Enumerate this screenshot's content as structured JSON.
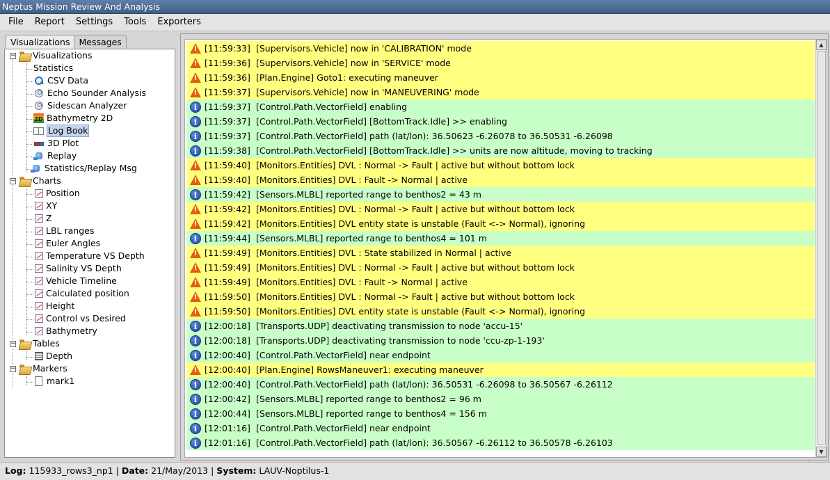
{
  "window": {
    "title": "Neptus Mission Review And Analysis"
  },
  "menu": [
    "File",
    "Report",
    "Settings",
    "Tools",
    "Exporters"
  ],
  "tabs": {
    "visualizations": "Visualizations",
    "messages": "Messages"
  },
  "tree": {
    "visualizations": "Visualizations",
    "statistics": "Statistics",
    "csv_data": "CSV Data",
    "echo_sounder": "Echo Sounder Analysis",
    "sidescan": "Sidescan Analyzer",
    "bathymetry2d": "Bathymetry 2D",
    "bathymetry2d_icon_text": "2D",
    "log_book": "Log Book",
    "plot3d": "3D Plot",
    "replay": "Replay",
    "statistics_replay": "Statistics/Replay Msg",
    "charts": "Charts",
    "chart_items": [
      "Position",
      "XY",
      "Z",
      "LBL ranges",
      "Euler Angles",
      "Temperature VS Depth",
      "Salinity VS Depth",
      "Vehicle Timeline",
      "Calculated position",
      "Height",
      "Control vs Desired",
      "Bathymetry"
    ],
    "tables": "Tables",
    "depth": "Depth",
    "markers": "Markers",
    "mark1": "mark1"
  },
  "log": [
    {
      "type": "warn",
      "time": "[11:59:33]",
      "msg": "[Supervisors.Vehicle] now in 'CALIBRATION' mode"
    },
    {
      "type": "warn",
      "time": "[11:59:36]",
      "msg": "[Supervisors.Vehicle] now in 'SERVICE' mode"
    },
    {
      "type": "warn",
      "time": "[11:59:36]",
      "msg": "[Plan.Engine] Goto1: executing maneuver"
    },
    {
      "type": "warn",
      "time": "[11:59:37]",
      "msg": "[Supervisors.Vehicle] now in 'MANEUVERING' mode"
    },
    {
      "type": "info",
      "time": "[11:59:37]",
      "msg": "[Control.Path.VectorField] enabling"
    },
    {
      "type": "info",
      "time": "[11:59:37]",
      "msg": "[Control.Path.VectorField] [BottomTrack.Idle] >> enabling"
    },
    {
      "type": "info",
      "time": "[11:59:37]",
      "msg": "[Control.Path.VectorField] path (lat/lon): 36.50623 -6.26078 to 36.50531 -6.26098"
    },
    {
      "type": "info",
      "time": "[11:59:38]",
      "msg": "[Control.Path.VectorField] [BottomTrack.Idle] >> units are now altitude, moving to tracking"
    },
    {
      "type": "warn",
      "time": "[11:59:40]",
      "msg": "[Monitors.Entities] DVL : Normal -> Fault | active but without bottom lock"
    },
    {
      "type": "warn",
      "time": "[11:59:40]",
      "msg": "[Monitors.Entities] DVL : Fault -> Normal | active"
    },
    {
      "type": "info",
      "time": "[11:59:42]",
      "msg": "[Sensors.MLBL] reported range to benthos2 = 43 m"
    },
    {
      "type": "warn",
      "time": "[11:59:42]",
      "msg": "[Monitors.Entities] DVL : Normal -> Fault | active but without bottom lock"
    },
    {
      "type": "warn",
      "time": "[11:59:42]",
      "msg": "[Monitors.Entities] DVL entity state is unstable (Fault <-> Normal), ignoring"
    },
    {
      "type": "info",
      "time": "[11:59:44]",
      "msg": "[Sensors.MLBL] reported range to benthos4 = 101 m"
    },
    {
      "type": "warn",
      "time": "[11:59:49]",
      "msg": "[Monitors.Entities] DVL : State stabilized in Normal | active"
    },
    {
      "type": "warn",
      "time": "[11:59:49]",
      "msg": "[Monitors.Entities] DVL : Normal -> Fault | active but without bottom lock"
    },
    {
      "type": "warn",
      "time": "[11:59:49]",
      "msg": "[Monitors.Entities] DVL : Fault -> Normal | active"
    },
    {
      "type": "warn",
      "time": "[11:59:50]",
      "msg": "[Monitors.Entities] DVL : Normal -> Fault | active but without bottom lock"
    },
    {
      "type": "warn",
      "time": "[11:59:50]",
      "msg": "[Monitors.Entities] DVL entity state is unstable (Fault <-> Normal), ignoring"
    },
    {
      "type": "info",
      "time": "[12:00:18]",
      "msg": "[Transports.UDP] deactivating transmission to node 'accu-15'"
    },
    {
      "type": "info",
      "time": "[12:00:18]",
      "msg": "[Transports.UDP] deactivating transmission to node 'ccu-zp-1-193'"
    },
    {
      "type": "info",
      "time": "[12:00:40]",
      "msg": "[Control.Path.VectorField] near endpoint"
    },
    {
      "type": "warn",
      "time": "[12:00:40]",
      "msg": "[Plan.Engine] RowsManeuver1: executing maneuver"
    },
    {
      "type": "info",
      "time": "[12:00:40]",
      "msg": "[Control.Path.VectorField] path (lat/lon): 36.50531 -6.26098 to 36.50567 -6.26112"
    },
    {
      "type": "info",
      "time": "[12:00:42]",
      "msg": "[Sensors.MLBL] reported range to benthos2 = 96 m"
    },
    {
      "type": "info",
      "time": "[12:00:44]",
      "msg": "[Sensors.MLBL] reported range to benthos4 = 156 m"
    },
    {
      "type": "info",
      "time": "[12:01:16]",
      "msg": "[Control.Path.VectorField] near endpoint"
    },
    {
      "type": "info",
      "time": "[12:01:16]",
      "msg": "[Control.Path.VectorField] path (lat/lon): 36.50567 -6.26112 to 36.50578 -6.26103"
    }
  ],
  "status": {
    "log_label": "Log:",
    "log_value": "115933_rows3_np1",
    "date_label": "Date:",
    "date_value": "21/May/2013",
    "system_label": "System:",
    "system_value": "LAUV-Noptilus-1",
    "separator": " | "
  }
}
